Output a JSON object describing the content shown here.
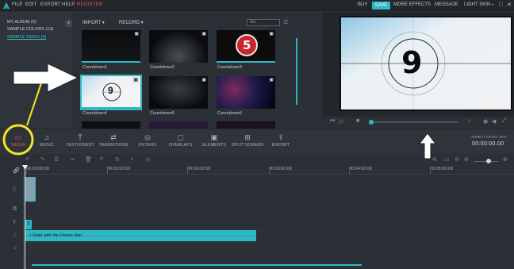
{
  "menu": {
    "items": [
      "FILE",
      "EDIT",
      "EXPORT",
      "HELP"
    ],
    "register": "REGISTER",
    "right": {
      "buy": "BUY",
      "save": "SAVE",
      "more_effects": "MORE EFFECTS",
      "message": "MESSAGE",
      "light_skin": "LIGHT SKIN"
    },
    "window": {
      "minimize": "–",
      "maximize": "□",
      "close": "✕"
    }
  },
  "albums": {
    "items": [
      {
        "label": "MY ALBUM (0)",
        "active": false
      },
      {
        "label": "SAMPLE COLORS (13)",
        "active": false
      },
      {
        "label": "SAMPLE VIDEO (9)",
        "active": true
      }
    ],
    "add": "+"
  },
  "library": {
    "import_label": "IMPORT",
    "record_label": "RECORD",
    "search_value": "ALL",
    "items": [
      {
        "label": "Countdown1",
        "icon": "video-icon"
      },
      {
        "label": "Countdown2",
        "icon": "video-icon"
      },
      {
        "label": "Countdown3",
        "icon": "video-icon",
        "badge": "5"
      },
      {
        "label": "Countdown4",
        "icon": "video-icon",
        "badge": "9",
        "selected": true
      },
      {
        "label": "Countdown5",
        "icon": "video-icon"
      },
      {
        "label": "Countdown6",
        "icon": "video-icon"
      }
    ]
  },
  "preview": {
    "number": "9"
  },
  "toolbar": {
    "items": [
      {
        "key": "media",
        "label": "MEDIA",
        "icon": "▭",
        "active": true
      },
      {
        "key": "music",
        "label": "MUSIC",
        "icon": "♫",
        "active": false
      },
      {
        "key": "text",
        "label": "TEXT/CREDIT",
        "icon": "T",
        "active": false
      },
      {
        "key": "transitions",
        "label": "TRANSITIONS",
        "icon": "⇄",
        "active": false
      },
      {
        "key": "filters",
        "label": "FILTERS",
        "icon": "◎",
        "active": false
      },
      {
        "key": "overlays",
        "label": "OVERLAYS",
        "icon": "▢",
        "active": false
      },
      {
        "key": "elements",
        "label": "ELEMENTS",
        "icon": "▣",
        "active": false
      },
      {
        "key": "split",
        "label": "SPLIT SCREEN",
        "icon": "⊞",
        "active": false
      },
      {
        "key": "export",
        "label": "EXPORT",
        "icon": "⇪",
        "active": false
      }
    ],
    "aspect_ratio": "ASPECT RATIO: 16:9",
    "timecode": "00:00:00.00"
  },
  "timeline": {
    "ticks": [
      "00:00:00:00",
      "00:01:00:00",
      "00:02:00:00",
      "00:03:00:00",
      "00:04:00:00",
      "00:05:00:00"
    ],
    "text_clip": "T",
    "music_clip_label": "Maid with the Flaxen Hair"
  },
  "colors": {
    "accent": "#2fb8c4",
    "active": "#e0584b",
    "annotation": "#f5e625",
    "arrow": "#ffffff"
  }
}
